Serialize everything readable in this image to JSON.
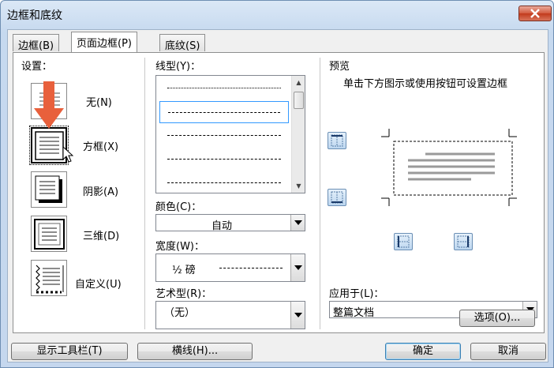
{
  "window": {
    "title": "边框和底纹"
  },
  "tabs": [
    {
      "label": "边框(B)",
      "active": false
    },
    {
      "label": "页面边框(P)",
      "active": true
    },
    {
      "label": "底纹(S)",
      "active": false
    }
  ],
  "settings": {
    "label": "设置：",
    "items": [
      {
        "label": "无(N)",
        "icon": "none-border-icon"
      },
      {
        "label": "方框(X)",
        "icon": "box-border-icon",
        "selected": true
      },
      {
        "label": "阴影(A)",
        "icon": "shadow-border-icon"
      },
      {
        "label": "三维(D)",
        "icon": "3d-border-icon"
      },
      {
        "label": "自定义(U)",
        "icon": "custom-border-icon"
      }
    ]
  },
  "line_style": {
    "label": "线型(Y)：",
    "selected_index": 1
  },
  "color": {
    "label": "颜色(C)：",
    "value": "自动"
  },
  "width": {
    "label": "宽度(W)：",
    "value": "½ 磅"
  },
  "art": {
    "label": "艺术型(R)：",
    "value": "（无）"
  },
  "preview": {
    "label": "预览",
    "hint": "单击下方图示或使用按钮可设置边框"
  },
  "apply_to": {
    "label": "应用于(L)：",
    "value": "整篇文档"
  },
  "buttons": {
    "options": "选项(O)...",
    "show_toolbar": "显示工具栏(T)",
    "horizontal_line": "横线(H)...",
    "ok": "确定",
    "cancel": "取消"
  },
  "colors": {
    "accent_arrow": "#e8603c",
    "selection": "#3399ff"
  }
}
